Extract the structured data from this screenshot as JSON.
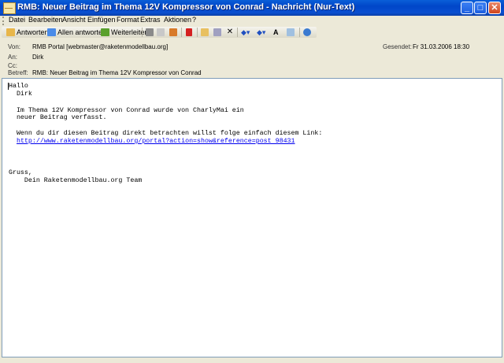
{
  "window": {
    "title": "RMB: Neuer Beitrag im Thema 12V Kompressor von Conrad - Nachricht (Nur-Text)",
    "buttons": {
      "minimize": "_",
      "maximize": "□",
      "close": "✕"
    }
  },
  "menu": [
    "Datei",
    "Bearbeiten",
    "Ansicht",
    "Einfügen",
    "Format",
    "Extras",
    "Aktionen",
    "?"
  ],
  "toolbar": {
    "reply": "Antworten",
    "reply_all": "Allen antworten",
    "forward": "Weiterleiten",
    "colors": {
      "reply": "#e8b64a",
      "reply_all": "#4a8be8",
      "forward": "#5aa02c",
      "flag": "#d42020",
      "delete": "#000000",
      "nav": "#2050c0"
    }
  },
  "header": {
    "from_label": "Von:",
    "from_value": "RMB Portal [webmaster@raketenmodellbau.org]",
    "to_label": "An:",
    "to_value": "Dirk",
    "cc_label": "Cc:",
    "cc_value": "",
    "subject_label": "Betreff:",
    "subject_value": "RMB: Neuer Beitrag im Thema 12V Kompressor von Conrad",
    "sent_label": "Gesendet:",
    "sent_value": "Fr 31.03.2006 18:30"
  },
  "body": {
    "line1": "Hallo",
    "line2": "  Dirk",
    "line3": "  Im Thema 12V Kompressor von Conrad wurde von CharlyMai ein",
    "line4": "  neuer Beitrag verfasst.",
    "line5": "  Wenn du dir diesen Beitrag direkt betrachten willst folge einfach diesem Link:",
    "link": "http://www.raketenmodellbau.org/portal?action=show&reference=post 98431",
    "line6": "Gruss,",
    "line7": "    Dein Raketenmodellbau.org Team"
  }
}
